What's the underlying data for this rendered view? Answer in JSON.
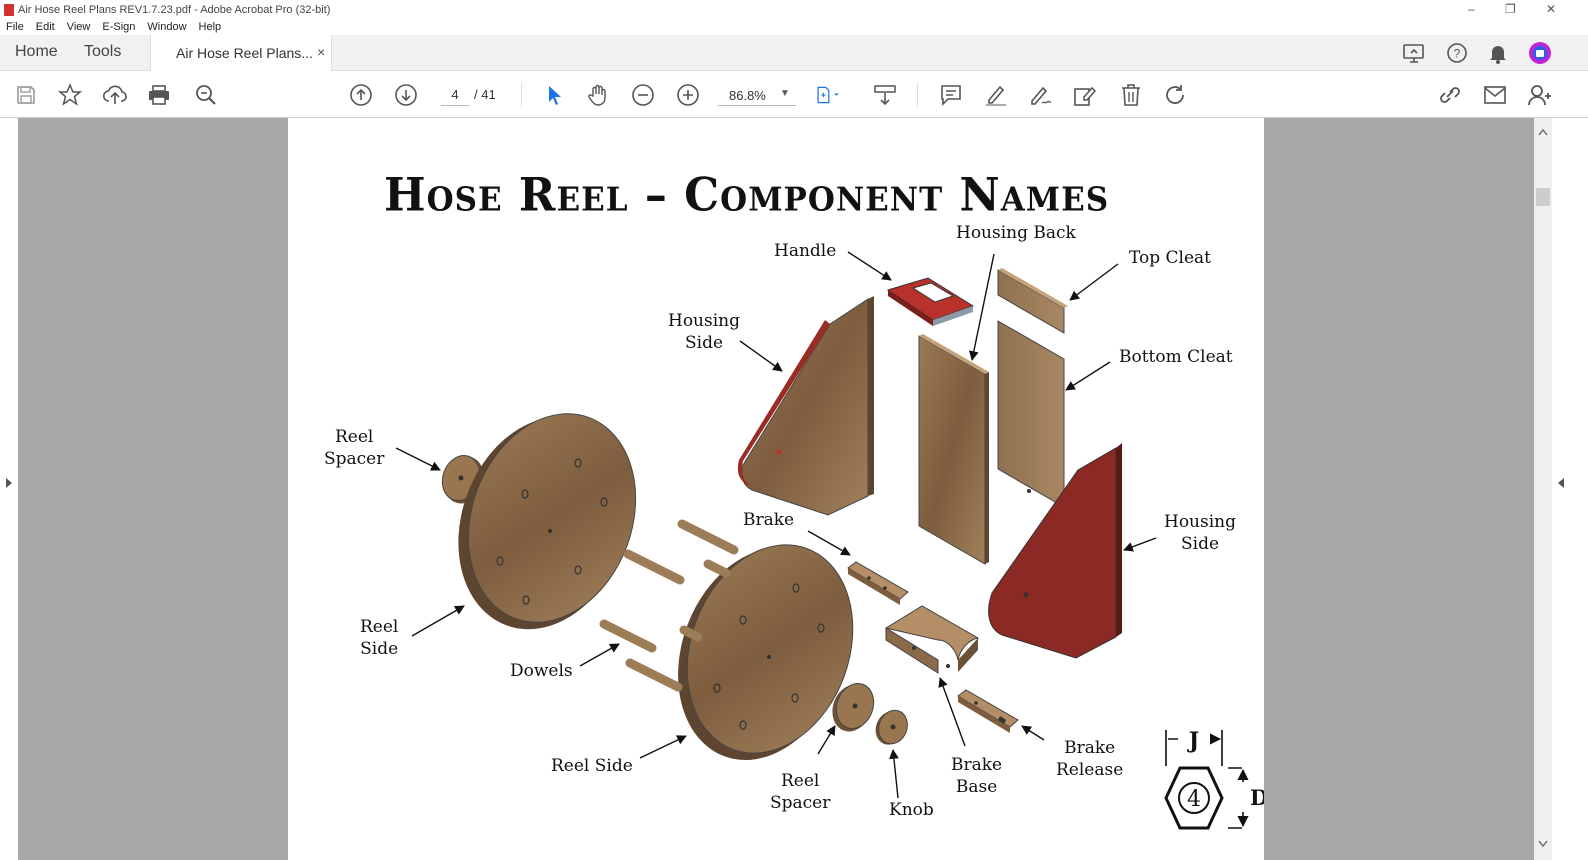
{
  "window": {
    "title": "Air Hose Reel Plans REV1.7.23.pdf - Adobe Acrobat Pro (32-bit)"
  },
  "menu": [
    "File",
    "Edit",
    "View",
    "E-Sign",
    "Window",
    "Help"
  ],
  "tabs": {
    "home": "Home",
    "tools": "Tools",
    "document": "Air Hose Reel Plans...",
    "close": "×"
  },
  "toolbar": {
    "page_current": "4",
    "page_total": "/ 41",
    "zoom": "86.8%"
  },
  "icons": {
    "save": "save-icon",
    "star": "star-icon",
    "upload": "upload-icon",
    "print": "print-icon",
    "search": "search-zoom-icon",
    "page_up": "arrow-up-icon",
    "page_down": "arrow-down-icon",
    "select": "cursor-icon",
    "hand": "hand-icon",
    "zoom_out": "zoom-out-icon",
    "zoom_in": "zoom-in-icon",
    "fit": "fit-page-icon",
    "scroll": "scroll-mode-icon",
    "comment": "comment-icon",
    "highlight": "highlight-icon",
    "sign": "sign-icon",
    "edit": "edit-icon",
    "delete": "trash-icon",
    "rotate": "rotate-icon",
    "link": "link-icon",
    "mail": "mail-icon",
    "share": "add-user-icon"
  },
  "colors": {
    "accent": "#1a73e8",
    "page_bg": "#a8a8a8",
    "red_part": "#8b2a24",
    "wood": "#8a6a48"
  },
  "document": {
    "title": "Hose Reel – Component Names",
    "labels": {
      "handle": "Handle",
      "housing_back": "Housing Back",
      "top_cleat": "Top Cleat",
      "housing_side_1": [
        "Housing",
        "Side"
      ],
      "bottom_cleat": "Bottom Cleat",
      "reel_spacer_1": [
        "Reel",
        "Spacer"
      ],
      "brake": "Brake",
      "housing_side_2": [
        "Housing",
        "Side"
      ],
      "reel_side_1": [
        "Reel",
        "Side"
      ],
      "dowels": "Dowels",
      "reel_side_2": "Reel Side",
      "reel_spacer_2": [
        "Reel",
        "Spacer"
      ],
      "knob": "Knob",
      "brake_base": [
        "Brake",
        "Base"
      ],
      "brake_release": [
        "Brake",
        "Release"
      ]
    },
    "badge": {
      "number": "4",
      "j": "J",
      "d": "D"
    }
  }
}
